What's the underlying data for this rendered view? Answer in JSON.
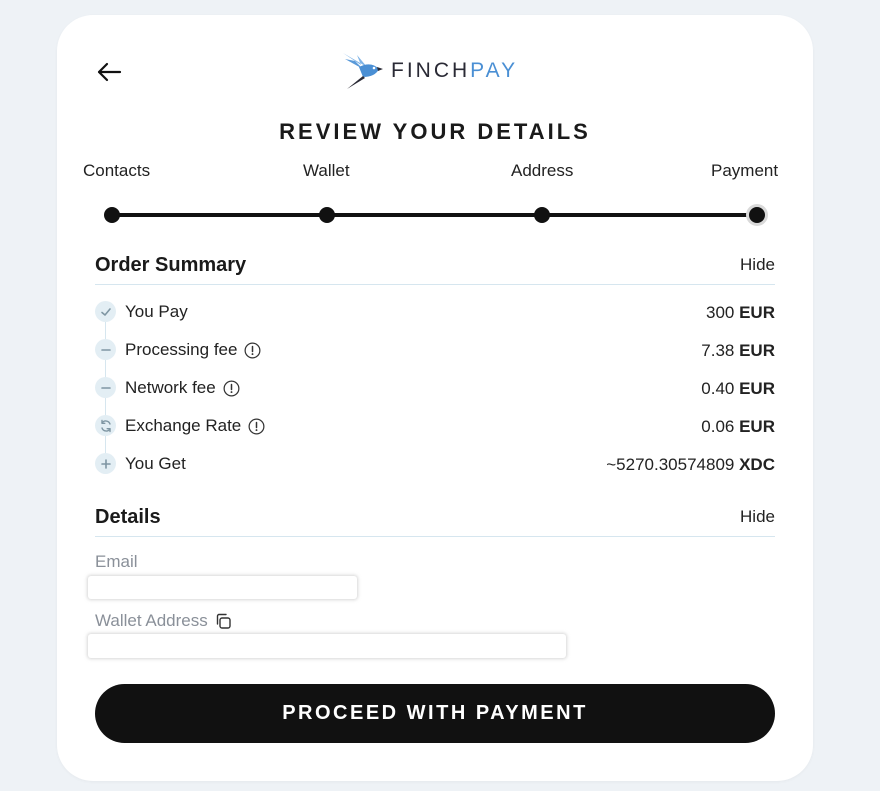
{
  "header": {
    "back_icon": "arrow-left-icon",
    "logo_icon": "finch-bird-icon",
    "logo_finch": "FINCH",
    "logo_pay": "PAY",
    "title": "REVIEW YOUR DETAILS"
  },
  "steps": [
    {
      "label": "Contacts"
    },
    {
      "label": "Wallet"
    },
    {
      "label": "Address"
    },
    {
      "label": "Payment",
      "current": true
    }
  ],
  "order_summary": {
    "title": "Order Summary",
    "toggle": "Hide",
    "rows": [
      {
        "icon": "check-icon",
        "label": "You Pay",
        "amount": "300",
        "currency": "EUR"
      },
      {
        "icon": "minus-icon",
        "label": "Processing fee",
        "info": true,
        "amount": "7.38",
        "currency": "EUR"
      },
      {
        "icon": "minus-icon",
        "label": "Network fee",
        "info": true,
        "amount": "0.40",
        "currency": "EUR"
      },
      {
        "icon": "exchange-icon",
        "label": "Exchange Rate",
        "info": true,
        "amount": "0.06",
        "currency": "EUR"
      },
      {
        "icon": "plus-icon",
        "label": "You Get",
        "amount": "~5270.30574809",
        "currency": "XDC"
      }
    ]
  },
  "details": {
    "title": "Details",
    "toggle": "Hide",
    "email_label": "Email",
    "wallet_label": "Wallet Address",
    "copy_icon": "copy-icon"
  },
  "proceed_label": "PROCEED WITH PAYMENT",
  "colors": {
    "background": "#eef2f6",
    "card": "#ffffff",
    "button": "#111111",
    "accent": "#4a8fd4",
    "divider": "#d6e6ef"
  }
}
